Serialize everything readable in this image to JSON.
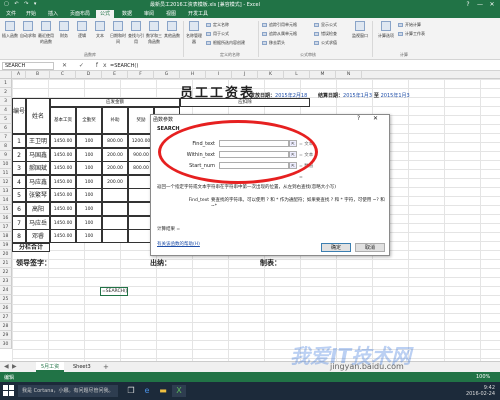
{
  "window": {
    "title": "最新员工2016工资表模板.xls [兼容模式] - Excel",
    "quick_access": "▢ ↶ ↷ ▾",
    "minimize": "—",
    "restore": "❐",
    "close": "✕"
  },
  "tabs": [
    "文件",
    "开始",
    "插入",
    "页面布局",
    "公式",
    "数据",
    "审阅",
    "视图",
    "开发工具"
  ],
  "ribbon": {
    "buttons": [
      "插入函数",
      "自动求和",
      "最近使用的函数",
      "财务",
      "逻辑",
      "文本",
      "日期和时间",
      "查找与引用",
      "数学和三角函数",
      "其他函数",
      "名称管理器"
    ],
    "name_items": [
      "定义名称",
      "用于公式",
      "根据所选内容创建"
    ],
    "audit_items": [
      "追踪引用单元格",
      "追踪从属单元格",
      "移去箭头",
      "显示公式",
      "错误检查",
      "公式求值"
    ],
    "watch": "监视窗口",
    "calc_items": [
      "计算选项",
      "开始计算",
      "计算工作表"
    ],
    "groups": [
      "函数库",
      "定义的名称",
      "公式审核",
      "计算"
    ]
  },
  "formula_bar": {
    "name_box": "SEARCH",
    "buttons": "✕ ✓ fx",
    "formula": "=SEARCH()"
  },
  "columns": [
    "A",
    "B",
    "C",
    "D",
    "E",
    "F",
    "G",
    "H",
    "I",
    "J",
    "K",
    "L",
    "M",
    "N"
  ],
  "rows": [
    "1",
    "2",
    "3",
    "4",
    "5",
    "6",
    "7",
    "8",
    "9",
    "10",
    "11",
    "12",
    "13",
    "14",
    "15",
    "16",
    "17",
    "18",
    "19",
    "20",
    "21",
    "22",
    "23",
    "24",
    "25",
    "26",
    "27",
    "28",
    "29",
    "30"
  ],
  "sheet": {
    "title": "员工工资表",
    "date_label": "发放日期：",
    "date_value": "2015年2月18",
    "period_label": "结算日期：",
    "period_value": "2015年1月3",
    "period_to": "至",
    "period_end": "2015年1月3",
    "headers": {
      "num": "编号",
      "name": "姓名",
      "due": "应发金额",
      "deduct": "应扣除",
      "base": "基本工资",
      "subsidy": "全勤奖",
      "bonus": "补助",
      "perf": "奖励",
      "extra": "外款"
    },
    "employees": [
      {
        "name": "王卫明",
        "base": "1450.00",
        "allday": "100",
        "bonus": "800.00",
        "perf": "1200.00",
        "extra": "100"
      },
      {
        "name": "马国鑫",
        "base": "1450.00",
        "allday": "100",
        "bonus": "200.00",
        "perf": "900.00",
        "extra": "100"
      },
      {
        "name": "郝国斌",
        "base": "1450.00",
        "allday": "100",
        "bonus": "200.00",
        "perf": "800.00",
        "extra": ""
      },
      {
        "name": "马应鑫",
        "base": "1450.00",
        "allday": "100",
        "bonus": "200.00",
        "perf": "",
        "extra": ""
      },
      {
        "name": "张繁琴",
        "base": "1450.00",
        "allday": "100",
        "bonus": "",
        "perf": "",
        "extra": ""
      },
      {
        "name": "高阳",
        "base": "1450.00",
        "allday": "100",
        "bonus": "",
        "perf": "",
        "extra": ""
      },
      {
        "name": "马应岳",
        "base": "1450.00",
        "allday": "100",
        "bonus": "",
        "perf": "",
        "extra": ""
      },
      {
        "name": "邓睿",
        "base": "1450.00",
        "allday": "100",
        "bonus": "",
        "perf": "",
        "extra": ""
      }
    ],
    "total_label": "分栏合计",
    "sign_leader": "领导签字：",
    "sign_cashier": "出纳：",
    "sign_maker": "制表：",
    "active_cell_text": "=SEARCH()"
  },
  "dialog": {
    "title": "函数参数",
    "help": "?",
    "close": "✕",
    "function": "SEARCH",
    "args": [
      {
        "label": "Find_text",
        "result": "= 文本"
      },
      {
        "label": "Within_text",
        "result": "= 文本"
      },
      {
        "label": "Start_num",
        "result": "= 数值"
      }
    ],
    "picker_glyph": "⇱",
    "equals": "=",
    "func_desc": "返回一个指定字符或文本字符串在字符串中第一次出现的位置，从左到右查找(忽略大小写)",
    "arg_desc_label": "Find_text",
    "arg_desc": "要查找的字符串。可以使用 ? 和 * 作为通配符；如果要查找 ? 和 * 字符，可使用 ~? 和 ~*",
    "calc_label": "计算结果 =",
    "help_link": "有关该函数的帮助(H)",
    "ok": "确定",
    "cancel": "取消"
  },
  "sheet_tabs": [
    "5月工资",
    "Sheet3"
  ],
  "add_sheet": "+",
  "status": {
    "mode": "编辑",
    "zoom": "100%"
  },
  "taskbar": {
    "search_placeholder": "我是 Cortana，小娜。有问题尽管问我。",
    "time": "9:42",
    "date": "2016-02-24"
  },
  "watermark": {
    "logo": "我爱IT技术网",
    "url": "jingyan.baidu.com"
  },
  "colors": {
    "excel_green": "#217346",
    "highlight_red": "#e62020",
    "link_blue": "#1f4ea8"
  }
}
